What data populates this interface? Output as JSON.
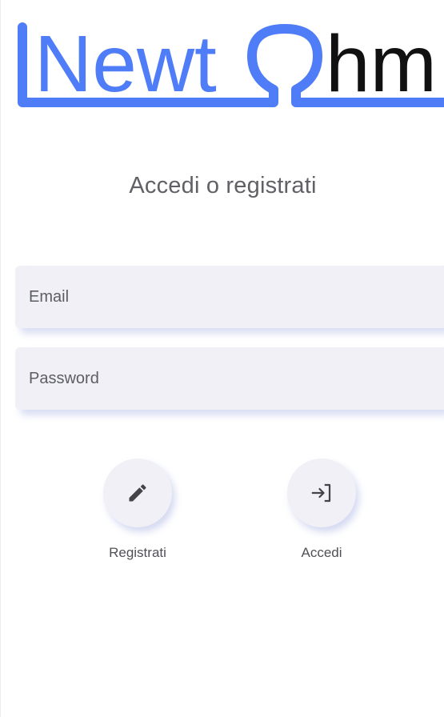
{
  "logo": {
    "text_newt": "Newt",
    "text_hm": "hm",
    "brand_color": "#4f7cf7",
    "dark_color": "#111111"
  },
  "subtitle": "Accedi o registrati",
  "form": {
    "email_placeholder": "Email",
    "email_value": "",
    "password_placeholder": "Password",
    "password_value": ""
  },
  "actions": {
    "register_label": "Registrati",
    "register_icon": "pencil-icon",
    "login_label": "Accedi",
    "login_icon": "login-arrow-icon"
  },
  "colors": {
    "field_bg": "#f0f0f6",
    "text_muted": "#606066",
    "icon": "#444448"
  }
}
